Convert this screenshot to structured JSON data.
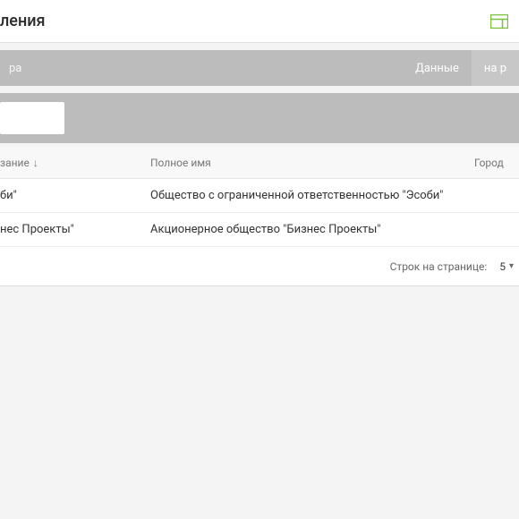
{
  "header": {
    "title": "ления"
  },
  "tabs": {
    "left_fragment": "ра",
    "items": [
      {
        "label": "Данные",
        "active": false
      },
      {
        "label": "на р",
        "active": true
      }
    ]
  },
  "filter": {
    "value": ""
  },
  "table": {
    "columns": {
      "name": "зание",
      "full": "Полное имя",
      "city": "Город"
    },
    "sort": "↓",
    "rows": [
      {
        "name": "би\"",
        "full": "Общество с ограниченной ответственностью \"Эсоби\"",
        "city": ""
      },
      {
        "name": "нес Проекты\"",
        "full": "Акционерное общество \"Бизнес Проекты\"",
        "city": ""
      }
    ]
  },
  "pagination": {
    "label": "Строк на странице:",
    "page_size": "5"
  }
}
